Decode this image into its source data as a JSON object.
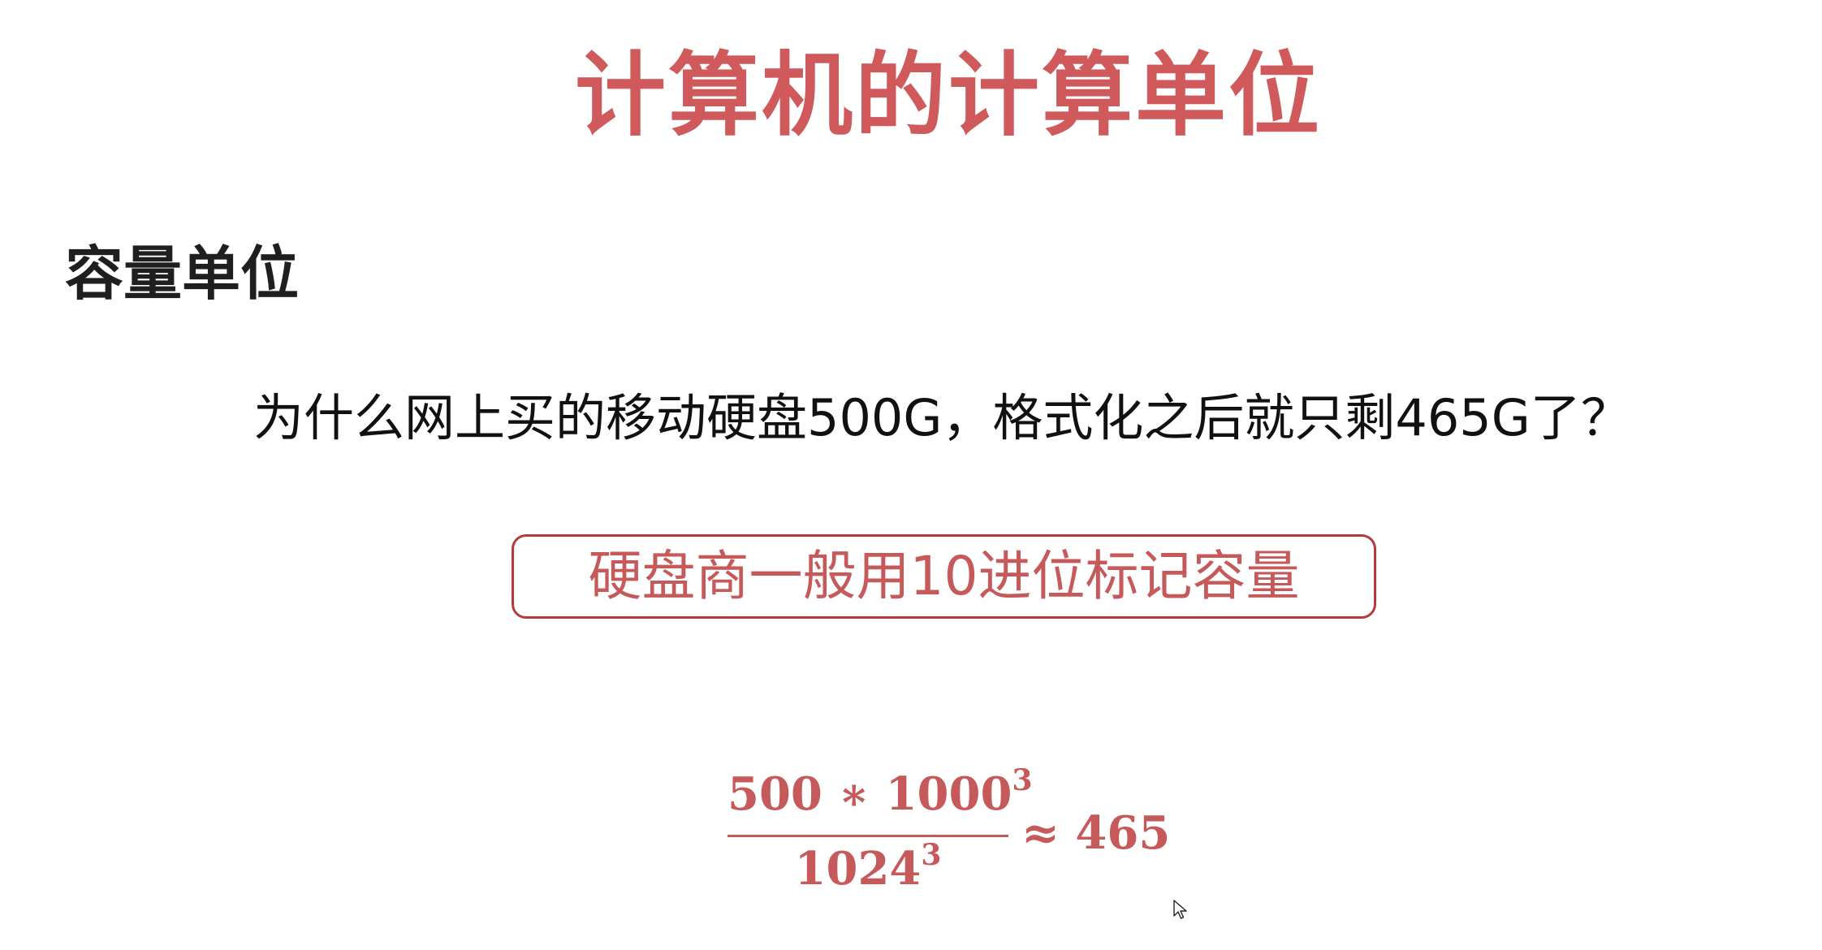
{
  "slide": {
    "title": "计算机的计算单位",
    "section_heading": "容量单位",
    "question": "为什么网上买的移动硬盘500G，格式化之后就只剩465G了？",
    "callout": "硬盘商一般用10进位标记容量",
    "formula": {
      "numerator_base": "500 ∗ 1000",
      "numerator_exponent": "3",
      "denominator_base": "1024",
      "denominator_exponent": "3",
      "approx_symbol": "≈",
      "result": "465"
    }
  },
  "colors": {
    "title": "#d0595b",
    "callout_border": "#b53b3b",
    "callout_text": "#c65a5a",
    "formula": "#c65a5a",
    "body_text": "#111111"
  },
  "icons": {
    "cursor": "mouse-pointer-icon"
  }
}
